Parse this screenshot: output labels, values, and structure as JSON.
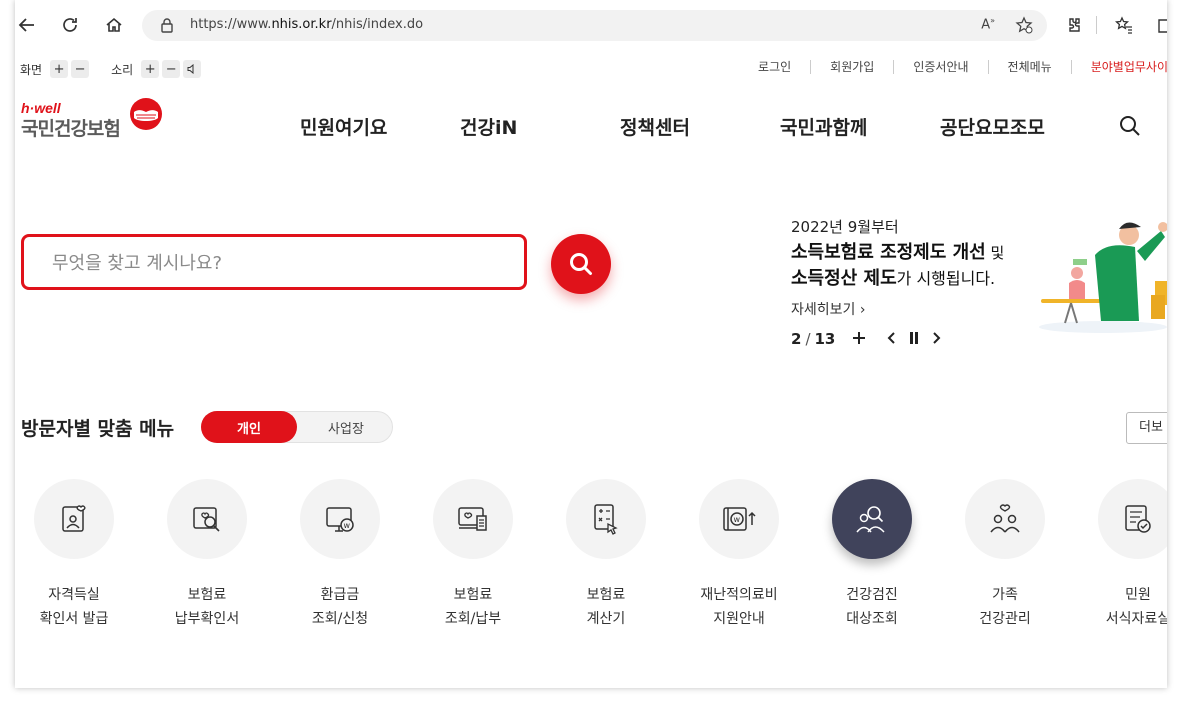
{
  "browser": {
    "url_prefix": "https://www.",
    "url_domain": "nhis.or.kr",
    "url_path": "/nhis/index.do",
    "read_aloud_label": "Aᴬ"
  },
  "util": {
    "screen_label": "화면",
    "sound_label": "소리",
    "plus": "+",
    "minus": "−",
    "links": [
      "로그인",
      "회원가입",
      "인증서안내",
      "전체메뉴",
      "분야별업무사이"
    ]
  },
  "logo": {
    "small": "h·well",
    "big": "국민건강보험"
  },
  "nav": [
    "민원여기요",
    "건강iN",
    "정책센터",
    "국민과함께",
    "공단요모조모"
  ],
  "search": {
    "placeholder": "무엇을 찾고 계시나요?"
  },
  "banner": {
    "subtitle": "2022년 9월부터",
    "line1_bold": "소득보험료 조정제도 개선",
    "line1_rest": " 및",
    "line2_bold": "소득정산 제도",
    "line2_rest": "가 시행됩니다.",
    "more": "자세히보기 ›",
    "current": "2",
    "sep": "/",
    "total": "13"
  },
  "visitor_menu": {
    "title": "방문자별 맞춤 메뉴",
    "tab_personal": "개인",
    "tab_business": "사업장",
    "more": "더보"
  },
  "items": [
    {
      "label": "자격득실\n확인서 발급",
      "icon": "id-card-heart-icon"
    },
    {
      "label": "보험료\n납부확인서",
      "icon": "search-heart-icon"
    },
    {
      "label": "환급금\n조회/신청",
      "icon": "monitor-won-icon"
    },
    {
      "label": "보험료\n조회/납부",
      "icon": "computer-receipt-icon"
    },
    {
      "label": "보험료\n계산기",
      "icon": "calculator-icon"
    },
    {
      "label": "재난적의료비\n지원안내",
      "icon": "wallet-won-icon"
    },
    {
      "label": "건강검진\n대상조회",
      "icon": "people-search-icon"
    },
    {
      "label": "가족\n건강관리",
      "icon": "family-heart-icon"
    },
    {
      "label": "민원\n서식자료실",
      "icon": "document-check-icon"
    }
  ],
  "colors": {
    "brand_red": "#e0121a",
    "dark_circle": "#40435b"
  }
}
